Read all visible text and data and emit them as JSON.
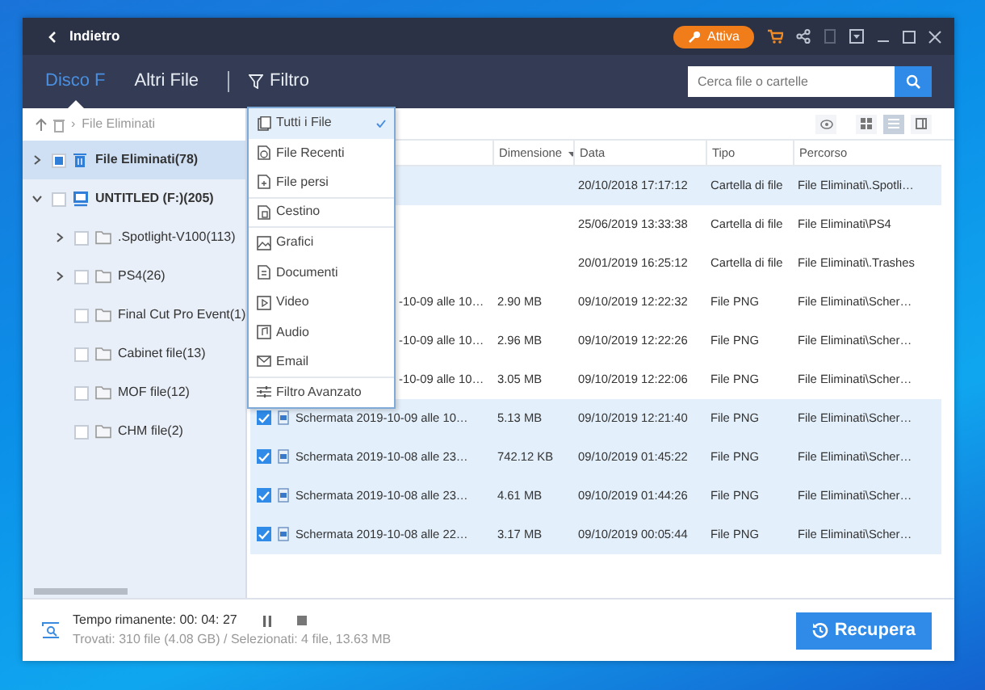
{
  "titlebar": {
    "back": "Indietro",
    "activate": "Attiva"
  },
  "tabs": [
    {
      "label": "Disco F",
      "selected": true
    },
    {
      "label": "Altri File",
      "selected": false
    }
  ],
  "filter": {
    "label": "Filtro"
  },
  "search": {
    "placeholder": "Cerca file o cartelle"
  },
  "breadcrumb": {
    "separator": "›",
    "current": "File Eliminati"
  },
  "views": [
    {
      "selected": false
    },
    {
      "selected": true
    },
    {
      "selected": false
    }
  ],
  "tree": [
    {
      "label": "File Eliminati(78)",
      "kind": "trash",
      "expanded": false,
      "partial": true,
      "selected": true
    },
    {
      "label": "UNTITLED (F:)(205)",
      "kind": "drive",
      "expanded": true,
      "partial": false,
      "selected": false,
      "children": [
        {
          "label": ".Spotlight-V100(113)",
          "kind": "folder",
          "expanded": false,
          "partial": false,
          "selected": false
        },
        {
          "label": "PS4(26)",
          "kind": "folder",
          "expanded": false,
          "partial": false,
          "selected": false
        },
        {
          "label": "Final Cut Pro Event(1)",
          "kind": "folder",
          "partial": false,
          "selected": false
        },
        {
          "label": "Cabinet file(13)",
          "kind": "folder",
          "partial": false,
          "selected": false
        },
        {
          "label": "MOF file(12)",
          "kind": "folder",
          "partial": false,
          "selected": false
        },
        {
          "label": "CHM file(2)",
          "kind": "folder",
          "partial": false,
          "selected": false
        }
      ]
    }
  ],
  "table": {
    "columns": [
      {
        "label": "Dimensione",
        "sorted": true
      },
      {
        "label": "Data",
        "sorted": false
      },
      {
        "label": "Tipo",
        "sorted": false
      },
      {
        "label": "Percorso",
        "sorted": false
      }
    ],
    "rows": [
      {
        "kind": "covered",
        "selected": true,
        "date": "20/10/2018 17:17:12",
        "type": "Cartella di file",
        "path": "File Eliminati\\.Spotli…"
      },
      {
        "kind": "covered",
        "selected": false,
        "date": "25/06/2019 13:33:38",
        "type": "Cartella di file",
        "path": "File Eliminati\\PS4"
      },
      {
        "kind": "covered",
        "selected": false,
        "date": "20/01/2019 16:25:12",
        "type": "Cartella di file",
        "path": "File Eliminati\\.Trashes"
      },
      {
        "kind": "covered",
        "selected": false,
        "name": "-10-09 alle 10…",
        "size": "2.90 MB",
        "date": "09/10/2019 12:22:32",
        "type": "File PNG",
        "path": "File Eliminati\\Scher…"
      },
      {
        "kind": "covered",
        "selected": false,
        "name": "-10-09 alle 10…",
        "size": "2.96 MB",
        "date": "09/10/2019 12:22:26",
        "type": "File PNG",
        "path": "File Eliminati\\Scher…"
      },
      {
        "kind": "covered",
        "selected": false,
        "name": "-10-09 alle 10…",
        "size": "3.05 MB",
        "date": "09/10/2019 12:22:06",
        "type": "File PNG",
        "path": "File Eliminati\\Scher…"
      },
      {
        "kind": "file",
        "selected": true,
        "checked": true,
        "name": "Schermata 2019-10-09 alle 10…",
        "size": "5.13 MB",
        "date": "09/10/2019 12:21:40",
        "type": "File PNG",
        "path": "File Eliminati\\Scher…"
      },
      {
        "kind": "file",
        "selected": true,
        "checked": true,
        "name": "Schermata 2019-10-08 alle 23…",
        "size": "742.12 KB",
        "date": "09/10/2019 01:45:22",
        "type": "File PNG",
        "path": "File Eliminati\\Scher…"
      },
      {
        "kind": "file",
        "selected": true,
        "checked": true,
        "name": "Schermata 2019-10-08 alle 23…",
        "size": "4.61 MB",
        "date": "09/10/2019 01:44:26",
        "type": "File PNG",
        "path": "File Eliminati\\Scher…"
      },
      {
        "kind": "file",
        "selected": true,
        "checked": true,
        "name": "Schermata 2019-10-08 alle 22…",
        "size": "3.17 MB",
        "date": "09/10/2019 00:05:44",
        "type": "File PNG",
        "path": "File Eliminati\\Scher…"
      }
    ]
  },
  "filter_menu": [
    {
      "label": "Tutti i File",
      "selected": true,
      "separator": false
    },
    {
      "label": "File Recenti",
      "selected": false,
      "separator": false
    },
    {
      "label": "File persi",
      "selected": false,
      "separator": true
    },
    {
      "label": "Cestino",
      "selected": false,
      "separator": true
    },
    {
      "label": "Grafici",
      "selected": false,
      "separator": false
    },
    {
      "label": "Documenti",
      "selected": false,
      "separator": false
    },
    {
      "label": "Video",
      "selected": false,
      "separator": false
    },
    {
      "label": "Audio",
      "selected": false,
      "separator": false
    },
    {
      "label": "Email",
      "selected": false,
      "separator": true
    },
    {
      "label": "Filtro Avanzato",
      "selected": false,
      "separator": false
    }
  ],
  "footer": {
    "time_left": "Tempo rimanente: 00: 04: 27",
    "summary": "Trovati: 310 file (4.08 GB) / Selezionati: 4 file, 13.63 MB",
    "recover": "Recupera"
  }
}
